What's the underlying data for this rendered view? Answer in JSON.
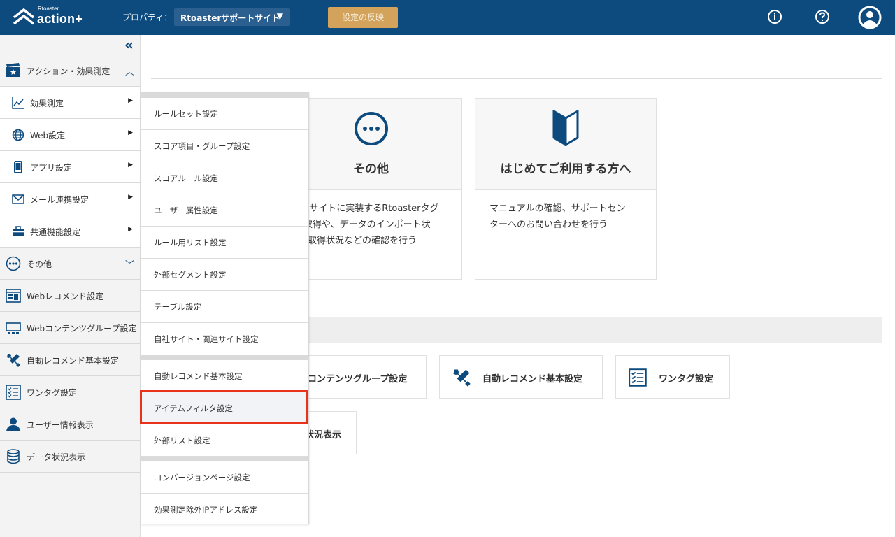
{
  "header": {
    "brand_small": "Rtoaster",
    "brand_main": "action+",
    "property_label": "プロパティ：",
    "property_value": "Rtoasterサポートサイト",
    "apply_label": "設定の反映"
  },
  "sidebar": {
    "items": [
      {
        "label": "アクション・効果測定"
      },
      {
        "label": "効果測定"
      },
      {
        "label": "Web設定"
      },
      {
        "label": "アプリ設定"
      },
      {
        "label": "メール連携設定"
      },
      {
        "label": "共通機能設定"
      },
      {
        "label": "その他"
      },
      {
        "label": "Webレコメンド設定"
      },
      {
        "label": "Webコンテンツグループ設定"
      },
      {
        "label": "自動レコメンド基本設定"
      },
      {
        "label": "ワンタグ設定"
      },
      {
        "label": "ユーザー情報表示"
      },
      {
        "label": "データ状況表示"
      }
    ]
  },
  "submenu": {
    "items": [
      {
        "label": "ルールセット設定"
      },
      {
        "label": "スコア項目・グループ設定"
      },
      {
        "label": "スコアルール設定"
      },
      {
        "label": "ユーザー属性設定"
      },
      {
        "label": "ルール用リスト設定"
      },
      {
        "label": "外部セグメント設定"
      },
      {
        "label": "テーブル設定"
      },
      {
        "label": "自社サイト・関連サイト設定"
      },
      {
        "label": "自動レコメンド基本設定"
      },
      {
        "label": "アイテムフィルタ設定"
      },
      {
        "label": "外部リスト設定"
      },
      {
        "label": "コンバージョンページ設定"
      },
      {
        "label": "効果測定除外IPアドレス設定"
      }
    ]
  },
  "cards": [
    {
      "title": "その他",
      "desc_lines": [
        "bサイトに実装するRtoasterタグ",
        "取得や、データのインポート状",
        "取得状況などの確認を行う"
      ]
    },
    {
      "title": "はじめてご利用する方へ",
      "desc_lines": [
        "マニュアルの確認、サポートセン",
        "ターへのお問い合わせを行う"
      ]
    }
  ],
  "quick": [
    {
      "label": "コンテンツグループ設定"
    },
    {
      "label": "自動レコメンド基本設定"
    },
    {
      "label": "ワンタグ設定"
    },
    {
      "label": "状況表示"
    }
  ],
  "colors": {
    "header": "#0d4a7e",
    "apply": "#d3a35b",
    "highlight": "#e8321a"
  }
}
